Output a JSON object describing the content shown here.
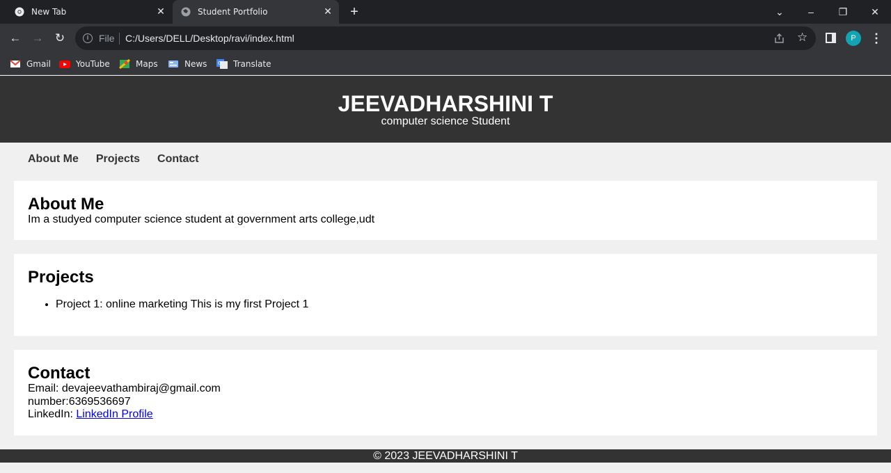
{
  "browser": {
    "tabs": [
      {
        "title": "New Tab",
        "active": false
      },
      {
        "title": "Student Portfolio",
        "active": true
      }
    ],
    "address": {
      "scheme_label": "File",
      "url": "C:/Users/DELL/Desktop/ravi/index.html"
    },
    "profile_initial": "P",
    "bookmarks": [
      {
        "label": "Gmail",
        "icon": "gmail-icon",
        "color": "#ea4335"
      },
      {
        "label": "YouTube",
        "icon": "youtube-icon",
        "color": "#ff0000"
      },
      {
        "label": "Maps",
        "icon": "maps-icon",
        "color": "#34a853"
      },
      {
        "label": "News",
        "icon": "news-icon",
        "color": "#8ab4f8"
      },
      {
        "label": "Translate",
        "icon": "translate-icon",
        "color": "#4285f4"
      }
    ]
  },
  "site": {
    "name": "JEEVADHARSHINI T",
    "tagline": "computer science Student",
    "nav": [
      "About Me",
      "Projects",
      "Contact"
    ],
    "about": {
      "heading": "About Me",
      "text": "Im a studyed computer science student at government arts college,udt"
    },
    "projects": {
      "heading": "Projects",
      "items": [
        "Project 1: online marketing This is my first Project 1"
      ]
    },
    "contact": {
      "heading": "Contact",
      "email_label": "Email:",
      "email": "devajeevathambiraj@gmail.com",
      "number_text": "number:6369536697",
      "linkedin_label": "LinkedIn:",
      "linkedin_link": "LinkedIn Profile"
    },
    "footer": "© 2023 JEEVADHARSHINI T"
  },
  "colors": {
    "header_bg": "#333333",
    "page_bg": "#f0f0f0",
    "link": "#0000ee"
  }
}
